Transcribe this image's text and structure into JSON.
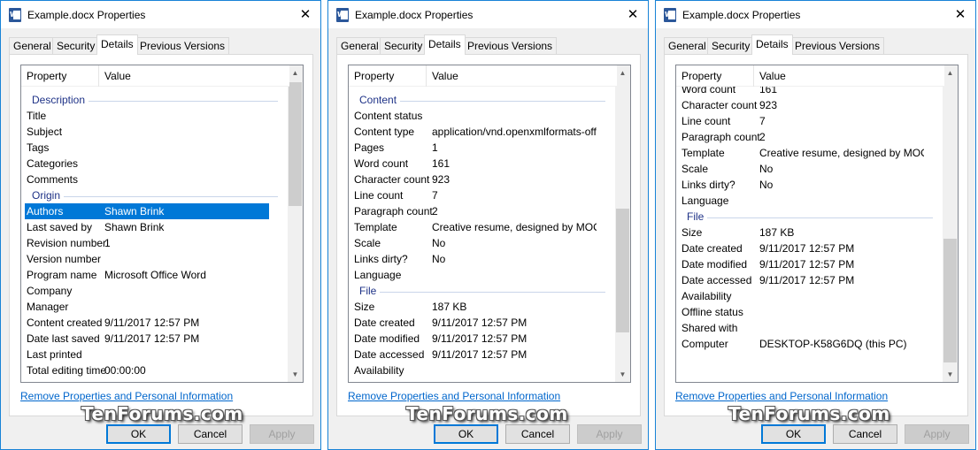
{
  "window_title": "Example.docx Properties",
  "tabs": [
    "General",
    "Security",
    "Details",
    "Previous Versions"
  ],
  "columns": {
    "property": "Property",
    "value": "Value"
  },
  "link_text": "Remove Properties and Personal Information",
  "buttons": {
    "ok": "OK",
    "cancel": "Cancel",
    "apply": "Apply"
  },
  "watermark": "TenForums.com",
  "icons": {
    "app": "word-document-icon",
    "close": "close-icon"
  },
  "accent_color": "#0078d7",
  "dialogs": [
    {
      "rows": [
        {
          "type": "group",
          "label": "Description"
        },
        {
          "k": "Title",
          "v": ""
        },
        {
          "k": "Subject",
          "v": ""
        },
        {
          "k": "Tags",
          "v": ""
        },
        {
          "k": "Categories",
          "v": ""
        },
        {
          "k": "Comments",
          "v": ""
        },
        {
          "type": "group",
          "label": "Origin"
        },
        {
          "k": "Authors",
          "v": "Shawn Brink",
          "selected": true
        },
        {
          "k": "Last saved by",
          "v": "Shawn Brink"
        },
        {
          "k": "Revision number",
          "v": "1"
        },
        {
          "k": "Version number",
          "v": ""
        },
        {
          "k": "Program name",
          "v": "Microsoft Office Word"
        },
        {
          "k": "Company",
          "v": ""
        },
        {
          "k": "Manager",
          "v": ""
        },
        {
          "k": "Content created",
          "v": "9/11/2017 12:57 PM"
        },
        {
          "k": "Date last saved",
          "v": "9/11/2017 12:57 PM"
        },
        {
          "k": "Last printed",
          "v": ""
        },
        {
          "k": "Total editing time",
          "v": "00:00:00"
        }
      ]
    },
    {
      "rows": [
        {
          "type": "group",
          "label": "Content"
        },
        {
          "k": "Content status",
          "v": ""
        },
        {
          "k": "Content type",
          "v": "application/vnd.openxmlformats-offi..."
        },
        {
          "k": "Pages",
          "v": "1"
        },
        {
          "k": "Word count",
          "v": "161"
        },
        {
          "k": "Character count",
          "v": "923"
        },
        {
          "k": "Line count",
          "v": "7"
        },
        {
          "k": "Paragraph count",
          "v": "2"
        },
        {
          "k": "Template",
          "v": "Creative resume, designed by MOO...."
        },
        {
          "k": "Scale",
          "v": "No"
        },
        {
          "k": "Links dirty?",
          "v": "No"
        },
        {
          "k": "Language",
          "v": ""
        },
        {
          "type": "group",
          "label": "File"
        },
        {
          "k": "Size",
          "v": "187 KB"
        },
        {
          "k": "Date created",
          "v": "9/11/2017 12:57 PM"
        },
        {
          "k": "Date modified",
          "v": "9/11/2017 12:57 PM"
        },
        {
          "k": "Date accessed",
          "v": "9/11/2017 12:57 PM"
        },
        {
          "k": "Availability",
          "v": ""
        }
      ]
    },
    {
      "rows": [
        {
          "k": "Word count",
          "v": "161"
        },
        {
          "k": "Character count",
          "v": "923"
        },
        {
          "k": "Line count",
          "v": "7"
        },
        {
          "k": "Paragraph count",
          "v": "2"
        },
        {
          "k": "Template",
          "v": "Creative resume, designed by MOO...."
        },
        {
          "k": "Scale",
          "v": "No"
        },
        {
          "k": "Links dirty?",
          "v": "No"
        },
        {
          "k": "Language",
          "v": ""
        },
        {
          "type": "group",
          "label": "File"
        },
        {
          "k": "Size",
          "v": "187 KB"
        },
        {
          "k": "Date created",
          "v": "9/11/2017 12:57 PM"
        },
        {
          "k": "Date modified",
          "v": "9/11/2017 12:57 PM"
        },
        {
          "k": "Date accessed",
          "v": "9/11/2017 12:57 PM"
        },
        {
          "k": "Availability",
          "v": ""
        },
        {
          "k": "Offline status",
          "v": ""
        },
        {
          "k": "Shared with",
          "v": ""
        },
        {
          "k": "Computer",
          "v": "DESKTOP-K58G6DQ (this PC)"
        }
      ]
    }
  ]
}
